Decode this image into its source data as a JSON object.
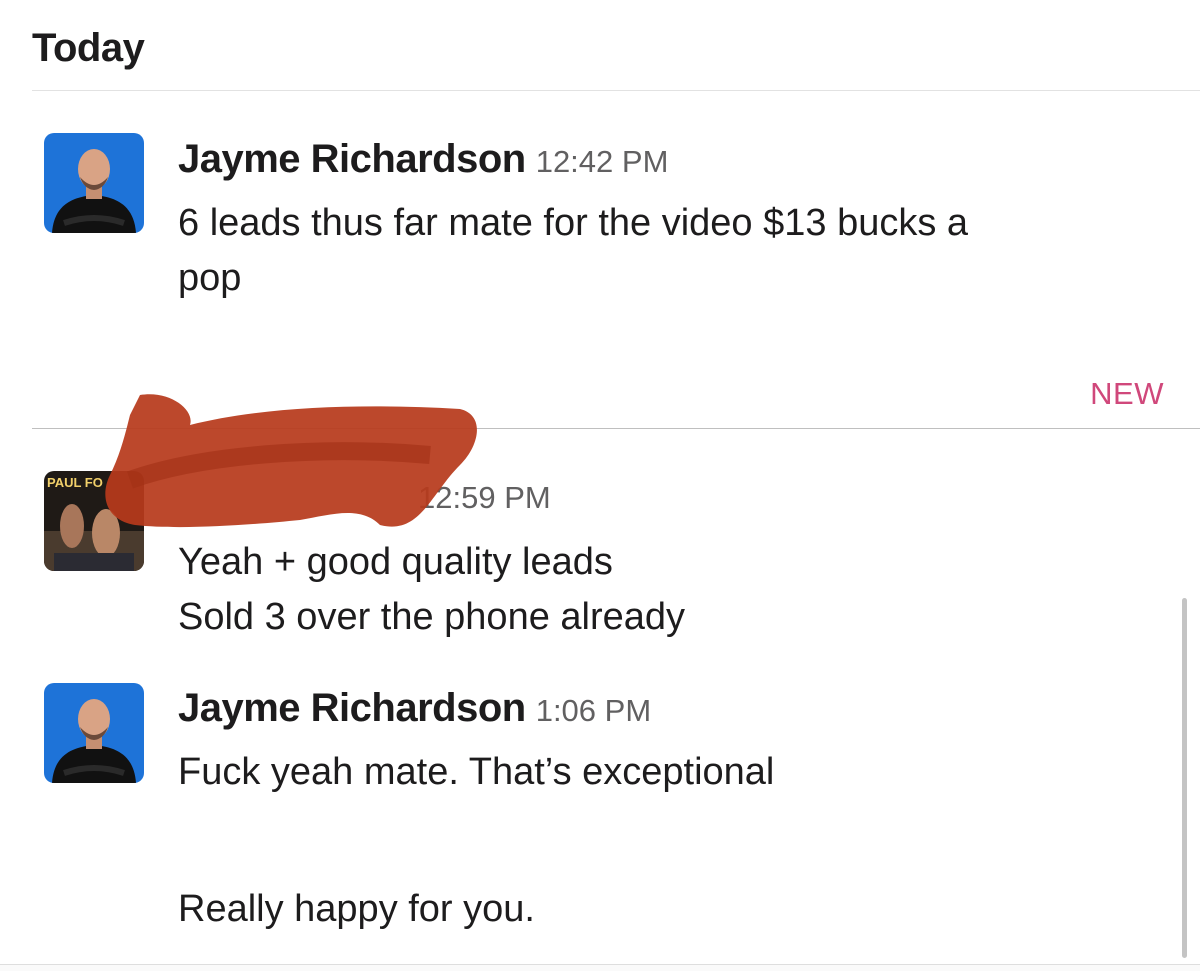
{
  "day_header": "Today",
  "new_label": "NEW",
  "messages": [
    {
      "sender": "Jayme Richardson",
      "time": "12:42 PM",
      "lines": [
        "6 leads thus far mate for the video $13 bucks a",
        "pop"
      ]
    },
    {
      "sender": "",
      "time": "12:59 PM",
      "avatar_text": "PAUL FO",
      "lines": [
        "Yeah + good quality leads",
        "Sold 3 over the phone already"
      ]
    },
    {
      "sender": "Jayme Richardson",
      "time": "1:06 PM",
      "lines": [
        "Fuck yeah mate. That’s exceptional",
        "",
        "Really happy for you."
      ]
    }
  ],
  "colors": {
    "new_accent": "#d0487b",
    "redaction": "#b73a1c",
    "avatar_bg": "#1e73d8"
  }
}
